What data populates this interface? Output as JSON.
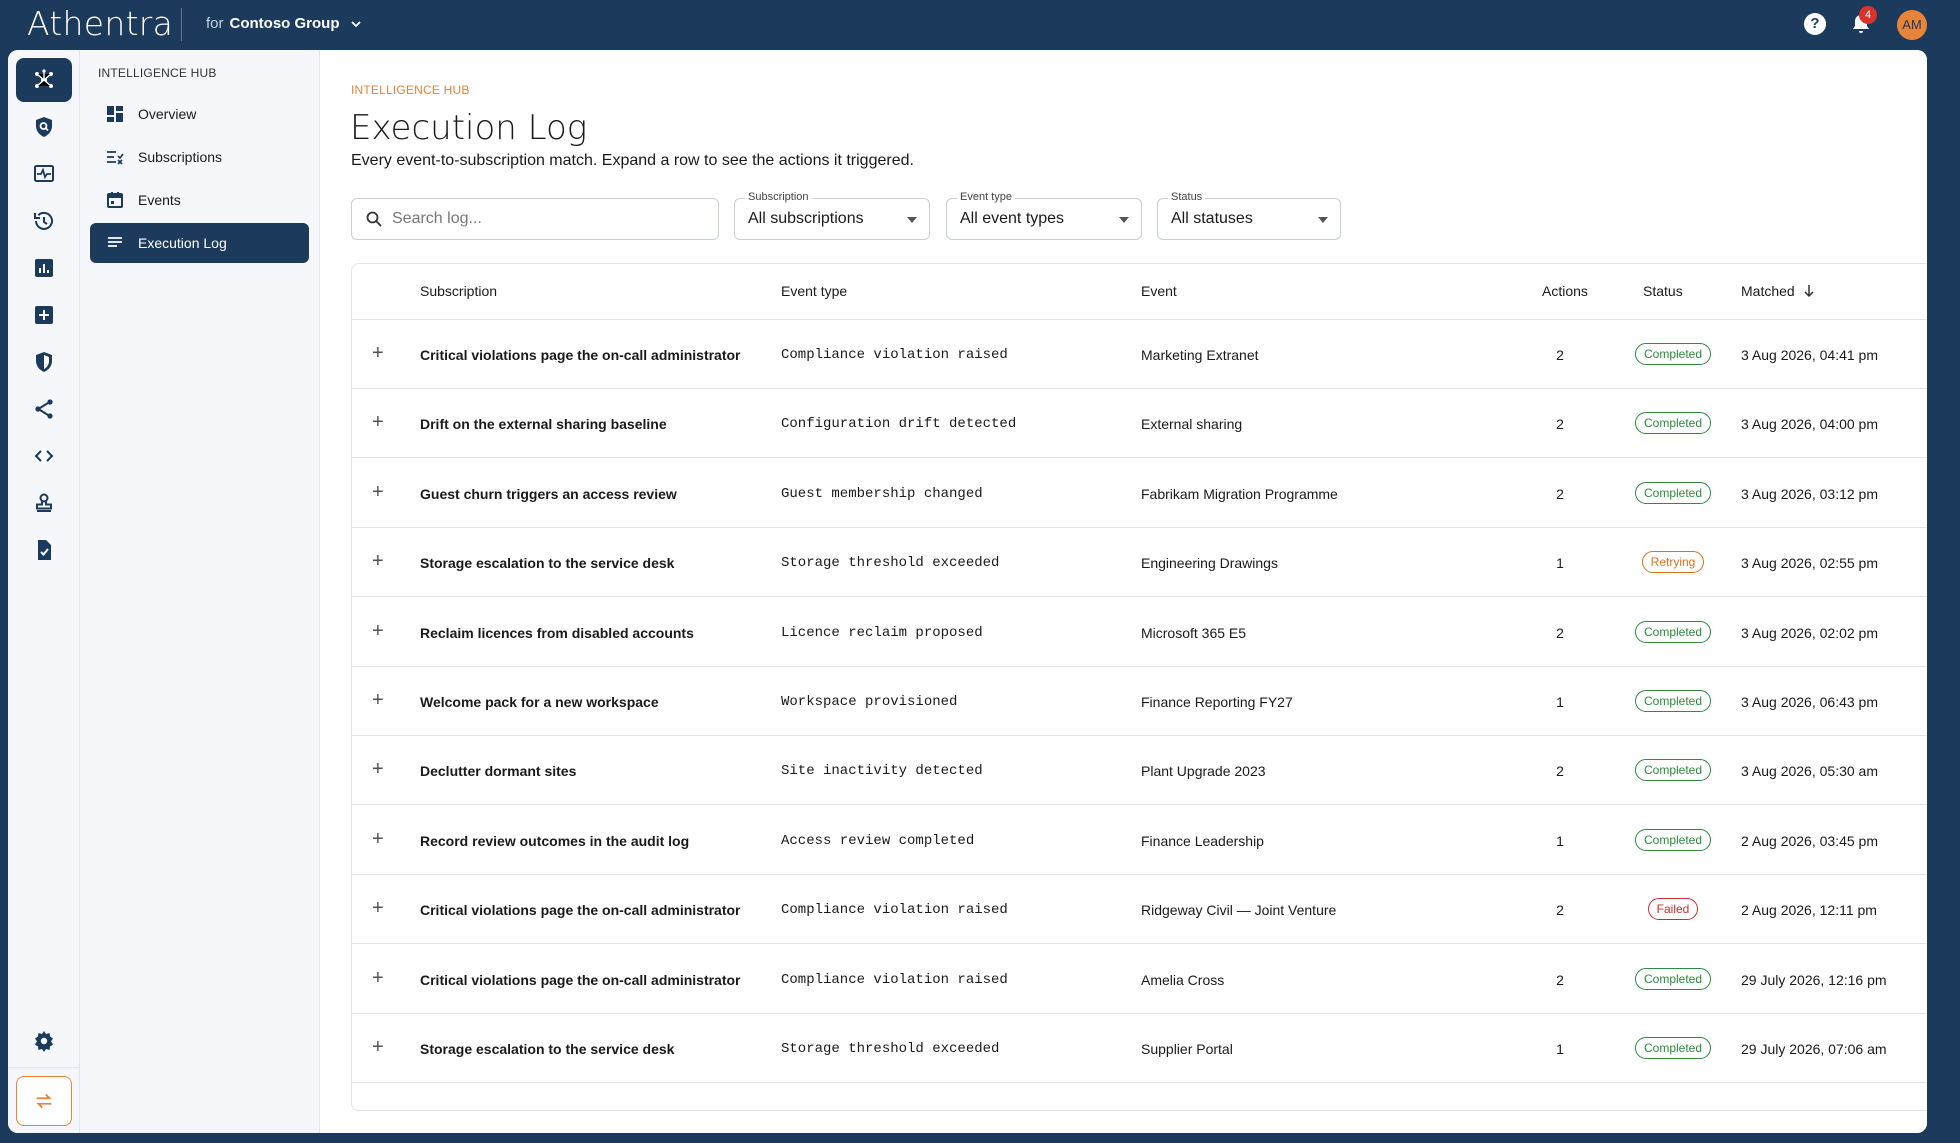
{
  "app": {
    "brand": "Athentra",
    "org_prefix": "for",
    "org_name": "Contoso Group",
    "notifications_count": "4",
    "user_initials": "AM"
  },
  "submenu": {
    "title": "INTELLIGENCE HUB",
    "items": [
      {
        "label": "Overview",
        "icon": "dashboard-icon"
      },
      {
        "label": "Subscriptions",
        "icon": "subscriptions-icon"
      },
      {
        "label": "Events",
        "icon": "calendar-icon"
      },
      {
        "label": "Execution Log",
        "icon": "list-icon",
        "active": true
      }
    ]
  },
  "page": {
    "breadcrumb": "INTELLIGENCE HUB",
    "title": "Execution Log",
    "subtitle": "Every event-to-subscription match. Expand a row to see the actions it triggered."
  },
  "filters": {
    "search_placeholder": "Search log...",
    "subscription": {
      "label": "Subscription",
      "value": "All subscriptions"
    },
    "event_type": {
      "label": "Event type",
      "value": "All event types"
    },
    "status": {
      "label": "Status",
      "value": "All statuses"
    }
  },
  "table": {
    "headers": {
      "subscription": "Subscription",
      "event_type": "Event type",
      "event": "Event",
      "actions": "Actions",
      "status": "Status",
      "matched": "Matched"
    },
    "rows": [
      {
        "subscription": "Critical violations page the on-call administrator",
        "event_type": "Compliance violation raised",
        "event": "Marketing Extranet",
        "actions": "2",
        "status": "Completed",
        "matched": "3 Aug 2026, 04:41 pm"
      },
      {
        "subscription": "Drift on the external sharing baseline",
        "event_type": "Configuration drift detected",
        "event": "External sharing",
        "actions": "2",
        "status": "Completed",
        "matched": "3 Aug 2026, 04:00 pm"
      },
      {
        "subscription": "Guest churn triggers an access review",
        "event_type": "Guest membership changed",
        "event": "Fabrikam Migration Programme",
        "actions": "2",
        "status": "Completed",
        "matched": "3 Aug 2026, 03:12 pm"
      },
      {
        "subscription": "Storage escalation to the service desk",
        "event_type": "Storage threshold exceeded",
        "event": "Engineering Drawings",
        "actions": "1",
        "status": "Retrying",
        "matched": "3 Aug 2026, 02:55 pm"
      },
      {
        "subscription": "Reclaim licences from disabled accounts",
        "event_type": "Licence reclaim proposed",
        "event": "Microsoft 365 E5",
        "actions": "2",
        "status": "Completed",
        "matched": "3 Aug 2026, 02:02 pm"
      },
      {
        "subscription": "Welcome pack for a new workspace",
        "event_type": "Workspace provisioned",
        "event": "Finance Reporting FY27",
        "actions": "1",
        "status": "Completed",
        "matched": "3 Aug 2026, 06:43 pm"
      },
      {
        "subscription": "Declutter dormant sites",
        "event_type": "Site inactivity detected",
        "event": "Plant Upgrade 2023",
        "actions": "2",
        "status": "Completed",
        "matched": "3 Aug 2026, 05:30 am"
      },
      {
        "subscription": "Record review outcomes in the audit log",
        "event_type": "Access review completed",
        "event": "Finance Leadership",
        "actions": "1",
        "status": "Completed",
        "matched": "2 Aug 2026, 03:45 pm"
      },
      {
        "subscription": "Critical violations page the on-call administrator",
        "event_type": "Compliance violation raised",
        "event": "Ridgeway Civil — Joint Venture",
        "actions": "2",
        "status": "Failed",
        "matched": "2 Aug 2026, 12:11 pm"
      },
      {
        "subscription": "Critical violations page the on-call administrator",
        "event_type": "Compliance violation raised",
        "event": "Amelia Cross",
        "actions": "2",
        "status": "Completed",
        "matched": "29 July 2026, 12:16 pm"
      },
      {
        "subscription": "Storage escalation to the service desk",
        "event_type": "Storage threshold exceeded",
        "event": "Supplier Portal",
        "actions": "1",
        "status": "Completed",
        "matched": "29 July 2026, 07:06 am"
      }
    ]
  },
  "colors": {
    "navy": "#1b3a5c",
    "accent": "#e8833a",
    "completed": "#2d8a3e",
    "retrying": "#d9731f",
    "failed": "#c62f2f"
  }
}
